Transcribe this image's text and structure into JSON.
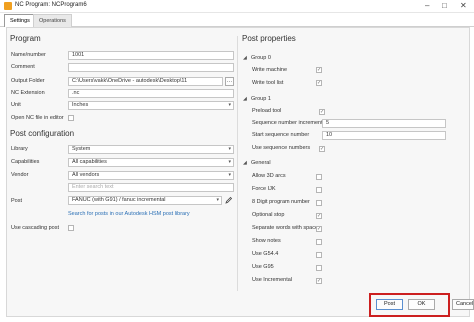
{
  "window": {
    "title": "NC Program: NCProgram6"
  },
  "tabs": [
    {
      "label": "Settings"
    },
    {
      "label": "Operations"
    }
  ],
  "program": {
    "heading": "Program",
    "name_label": "Name/number",
    "name_value": "1001",
    "comment_label": "Comment",
    "comment_value": "",
    "folder_label": "Output Folder",
    "folder_value": "C:\\Users\\vakk\\OneDrive - autodesk\\Desktop\\11",
    "ext_label": "NC Extension",
    "ext_value": ".nc",
    "unit_label": "Unit",
    "unit_value": "Inches",
    "open_label": "Open NC file in editor"
  },
  "post_config": {
    "heading": "Post configuration",
    "library_label": "Library",
    "library_value": "System",
    "capabilities_label": "Capabilities",
    "capabilities_value": "All capabilities",
    "vendor_label": "Vendor",
    "vendor_value": "All vendors",
    "search_placeholder": "Enter search text",
    "post_label": "Post",
    "post_value": "FANUC (with G91) / fanuc incremental",
    "search_link": "Search for posts in our Autodesk HSM post library",
    "cascading_label": "Use cascading post"
  },
  "post_properties": {
    "heading": "Post properties",
    "groups": [
      {
        "name": "Group 0",
        "props": [
          {
            "label": "Write machine",
            "checked": true
          },
          {
            "label": "Write tool list",
            "checked": true
          }
        ]
      },
      {
        "name": "Group 1",
        "props": [
          {
            "label": "Preload tool",
            "checked": true
          },
          {
            "label": "Sequence number increment",
            "value": "5"
          },
          {
            "label": "Start sequence number",
            "value": "10"
          },
          {
            "label": "Use sequence numbers",
            "checked": true
          }
        ]
      },
      {
        "name": "General",
        "props": [
          {
            "label": "Allow 3D arcs",
            "checked": false
          },
          {
            "label": "Force IJK",
            "checked": false
          },
          {
            "label": "8 Digit program number",
            "checked": false
          },
          {
            "label": "Optional stop",
            "checked": true
          },
          {
            "label": "Separate words with space",
            "checked": true
          },
          {
            "label": "Show notes",
            "checked": false
          },
          {
            "label": "Use G54.4",
            "checked": false
          },
          {
            "label": "Use G95",
            "checked": false
          },
          {
            "label": "Use Incremental",
            "checked": true
          }
        ]
      }
    ]
  },
  "buttons": {
    "post": "Post",
    "ok": "OK",
    "cancel": "Cancel"
  },
  "glyphs": {
    "check": "✓",
    "dropdown": "▾",
    "collapse": "◢",
    "minimize": "–",
    "maximize": "□",
    "close": "✕"
  },
  "colors": {
    "highlight": "#cc1f1f",
    "link": "#2a6fb5",
    "app_icon": "#f0a020"
  }
}
